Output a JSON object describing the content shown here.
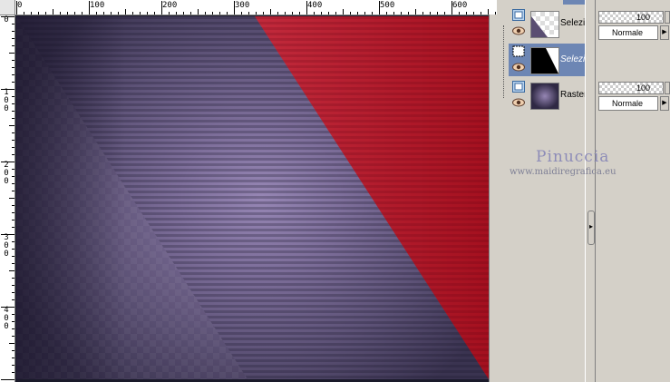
{
  "ruler": {
    "top_labels": [
      "0",
      "100",
      "200",
      "300",
      "400",
      "500",
      "600"
    ],
    "left_labels": [
      [
        "0"
      ],
      [
        "1",
        "0",
        "0"
      ],
      [
        "2",
        "0",
        "0"
      ],
      [
        "3",
        "0",
        "0"
      ],
      [
        "4",
        "0",
        "0"
      ]
    ]
  },
  "layers": [
    {
      "name": "Selezio",
      "selected": false,
      "icon": "selection-layer-icon",
      "thumb": "checker-gradient"
    },
    {
      "name": "Selezio",
      "selected": true,
      "icon": "selection-dotted-icon",
      "thumb": "black-white-diagonal"
    },
    {
      "name": "Raster",
      "selected": false,
      "icon": "raster-layer-icon",
      "thumb": "purple-radial"
    }
  ],
  "layer_props": [
    {
      "opacity": "100",
      "blend": "Normale"
    },
    {
      "opacity": "100",
      "blend": "Normale"
    }
  ],
  "watermark": {
    "title": "Pinuccia",
    "url": "www.maidiregrafica.eu"
  },
  "colors": {
    "red": "#b81c2e",
    "purple_center": "#9686b4",
    "purple_edge": "#3a3350",
    "selection": "#6d86b4"
  }
}
